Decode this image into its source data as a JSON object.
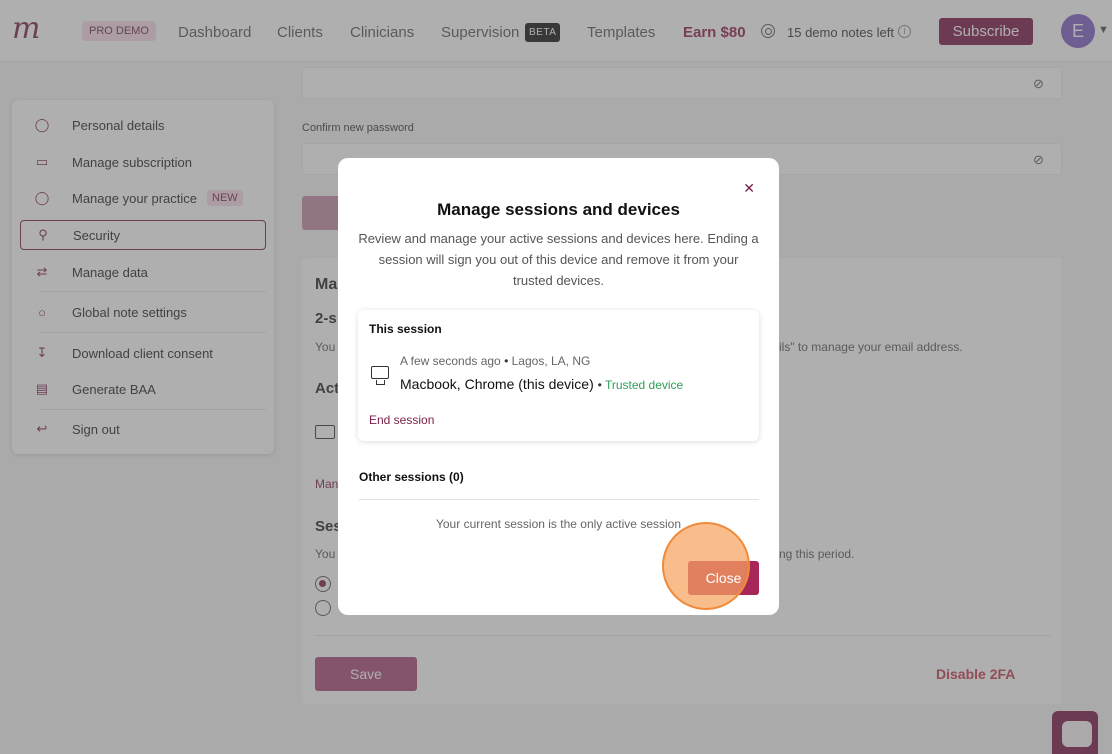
{
  "nav": {
    "logo": "m",
    "pro_demo": "PRO DEMO",
    "links": [
      "Dashboard",
      "Clients",
      "Clinicians",
      "Supervision",
      "Templates"
    ],
    "beta": "BETA",
    "earn": "Earn $80",
    "demo_notes": "15 demo notes left",
    "subscribe": "Subscribe",
    "avatar_initial": "E"
  },
  "sidebar": {
    "items": [
      {
        "label": "Personal details",
        "icon": "person-icon"
      },
      {
        "label": "Manage subscription",
        "icon": "card-icon"
      },
      {
        "label": "Manage your practice",
        "icon": "users-icon",
        "badge": "NEW"
      },
      {
        "label": "Security",
        "icon": "key-icon",
        "active": true
      },
      {
        "label": "Manage data",
        "icon": "data-icon"
      },
      {
        "label": "Global note settings",
        "icon": "coin-icon"
      },
      {
        "label": "Download client consent",
        "icon": "download-icon"
      },
      {
        "label": "Generate BAA",
        "icon": "document-icon"
      },
      {
        "label": "Sign out",
        "icon": "signout-icon"
      }
    ]
  },
  "content": {
    "confirm_label": "Confirm new password",
    "frag_ma": "Ma",
    "frag_2s": "2-s",
    "frag_you1": "You",
    "frag_email": "ils\" to manage your email address.",
    "frag_act": "Act",
    "frag_man": "Man",
    "frag_ses": "Ses",
    "frag_you2": "You",
    "frag_period": "ng this period.",
    "save": "Save",
    "disable_2fa": "Disable 2FA"
  },
  "modal": {
    "title": "Manage sessions and devices",
    "description": "Review and manage your active sessions and devices here. Ending a session will sign you out of this device and remove it from your trusted devices.",
    "this_session_heading": "This session",
    "session_time": "A few seconds ago",
    "session_location": "Lagos, LA, NG",
    "session_device": "Macbook, Chrome (this device)",
    "trusted_label": "Trusted device",
    "end_session": "End session",
    "other_sessions_heading": "Other sessions (0)",
    "only_session_text": "Your current session is the only active session",
    "close": "Close"
  },
  "colors": {
    "brand": "#7a1447",
    "accent_pink": "#f6dbe6",
    "trusted_green": "#2f9e58",
    "danger": "#c23a4c",
    "highlight": "#f7a460"
  }
}
